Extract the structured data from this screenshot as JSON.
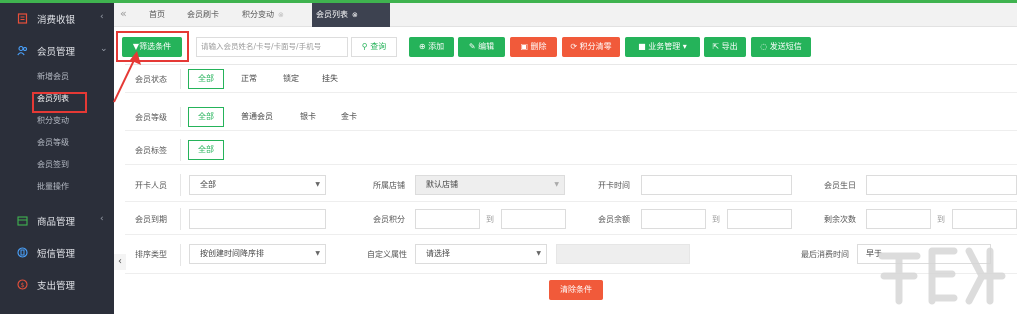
{
  "sidebar": {
    "groups": [
      {
        "label": "消费收银",
        "arrow": "‹"
      },
      {
        "label": "会员管理",
        "arrow": "⌄"
      },
      {
        "label": "商品管理",
        "arrow": "‹"
      },
      {
        "label": "短信管理"
      },
      {
        "label": "支出管理"
      }
    ],
    "sub_items": [
      "新增会员",
      "会员列表",
      "积分变动",
      "会员等级",
      "会员签到",
      "批量操作"
    ],
    "collapse": "‹"
  },
  "tabs": {
    "nav": "«",
    "items": [
      {
        "label": "首页"
      },
      {
        "label": "会员刷卡"
      },
      {
        "label": "积分变动",
        "close": "⊗"
      },
      {
        "label": "会员列表",
        "close": "⊗"
      }
    ]
  },
  "toolbar": {
    "filter": "▼筛选条件",
    "search_placeholder": "请输入会员姓名/卡号/卡面号/手机号",
    "query": "查询",
    "add": "添加",
    "edit": "编辑",
    "delete": "删除",
    "clear_points": "积分清零",
    "business": "业务管理 ▾",
    "export": "导出",
    "sms": "发送短信"
  },
  "filters": {
    "status": {
      "label": "会员状态",
      "options": [
        "全部",
        "正常",
        "锁定",
        "挂失"
      ]
    },
    "level": {
      "label": "会员等级",
      "options": [
        "全部",
        "普通会员",
        "银卡",
        "金卡"
      ]
    },
    "tag": {
      "label": "会员标签",
      "options": [
        "全部"
      ]
    },
    "card_staff": {
      "label": "开卡人员",
      "value": "全部"
    },
    "store": {
      "label": "所属店铺",
      "value": "默认店铺"
    },
    "card_time": {
      "label": "开卡时间"
    },
    "birthday": {
      "label": "会员生日"
    },
    "expiry": {
      "label": "会员到期"
    },
    "points": {
      "label": "会员积分",
      "to": "到"
    },
    "balance": {
      "label": "会员余额",
      "to": "到"
    },
    "remaining": {
      "label": "剩余次数",
      "to": "到"
    },
    "sort": {
      "label": "排序类型",
      "value": "按创建时间降序排"
    },
    "custom": {
      "label": "自定义属性",
      "value": "请选择"
    },
    "last_consume": {
      "label": "最后消费时间",
      "value": "早于"
    },
    "clear": "清除条件"
  },
  "colors": {
    "green": "#25b35a",
    "red": "#f15a3a",
    "sidebar": "#2b2f3a",
    "annotation": "#e53935"
  }
}
